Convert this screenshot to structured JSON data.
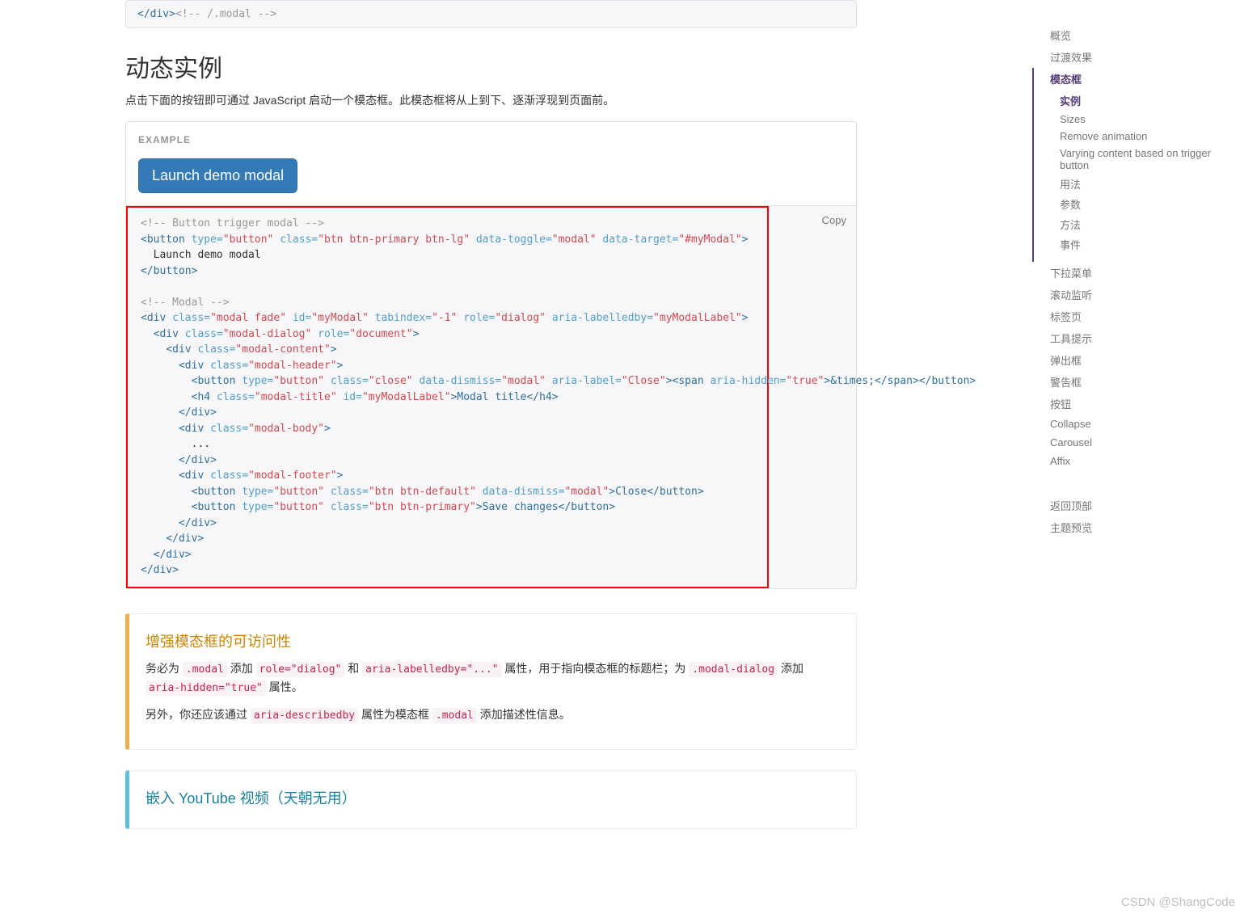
{
  "pretop": {
    "closing_tag": "</div>",
    "comment": "<!-- /.modal -->"
  },
  "section": {
    "title": "动态实例",
    "desc": "点击下面的按钮即可通过 JavaScript 启动一个模态框。此模态框将从上到下、逐渐浮现到页面前。"
  },
  "example": {
    "label": "EXAMPLE",
    "button_label": "Launch demo modal"
  },
  "code_actions": {
    "copy": "Copy"
  },
  "code": {
    "c1": "<!-- Button trigger modal -->",
    "btn_open": "<button",
    "type_attr": "type=",
    "type_val": "\"button\"",
    "class_attr": "class=",
    "btn_class_val": "\"btn btn-primary btn-lg\"",
    "toggle_attr": "data-toggle=",
    "toggle_val": "\"modal\"",
    "target_attr": "data-target=",
    "target_val": "\"#myModal\"",
    "gt": ">",
    "btn_text": "  Launch demo modal",
    "btn_close": "</button>",
    "c2": "<!-- Modal -->",
    "div_open": "<div",
    "modal_class_val": "\"modal fade\"",
    "id_attr": "id=",
    "modal_id_val": "\"myModal\"",
    "tabindex_attr": "tabindex=",
    "tabindex_val": "\"-1\"",
    "role_attr": "role=",
    "role_dialog_val": "\"dialog\"",
    "aria_lb_attr": "aria-labelledby=",
    "aria_lb_val": "\"myModalLabel\"",
    "dialog_class_val": "\"modal-dialog\"",
    "role_doc_val": "\"document\"",
    "content_class_val": "\"modal-content\"",
    "header_class_val": "\"modal-header\"",
    "close_class_val": "\"close\"",
    "dismiss_attr": "data-dismiss=",
    "dismiss_val": "\"modal\"",
    "aria_label_attr": "aria-label=",
    "aria_label_val": "\"Close\"",
    "span_open": "><span",
    "aria_hidden_attr": "aria-hidden=",
    "aria_hidden_val": "\"true\"",
    "times": ">&times;",
    "span_close": "</span>",
    "button_close_tag": "</button>",
    "h4_open": "<h4",
    "title_class_val": "\"modal-title\"",
    "title_id_val": "\"myModalLabel\"",
    "title_text": ">Modal title",
    "h4_close": "</h4>",
    "div_close": "</div>",
    "body_class_val": "\"modal-body\"",
    "ellipsis": "...",
    "footer_class_val": "\"modal-footer\"",
    "btn_default_val": "\"btn btn-default\"",
    "close_text": ">Close",
    "btn_primary_val": "\"btn btn-primary\"",
    "save_text": ">Save changes"
  },
  "callout": {
    "title": "增强模态框的可访问性",
    "p1_a": "务必为 ",
    "p1_code1": ".modal",
    "p1_b": " 添加 ",
    "p1_code2": "role=\"dialog\"",
    "p1_c": " 和 ",
    "p1_code3": "aria-labelledby=\"...\"",
    "p1_d": " 属性，用于指向模态框的标题栏；为 ",
    "p1_code4": ".modal-dialog",
    "p1_e": " 添加 ",
    "p1_code5": "aria-hidden=\"true\"",
    "p1_f": " 属性。",
    "p2_a": "另外，你还应该通过 ",
    "p2_code1": "aria-describedby",
    "p2_b": " 属性为模态框 ",
    "p2_code2": ".modal",
    "p2_c": " 添加描述性信息。"
  },
  "callout2": {
    "title": "嵌入 YouTube 视频（天朝无用）"
  },
  "sidebar": {
    "items": [
      {
        "label": "概览"
      },
      {
        "label": "过渡效果"
      },
      {
        "label": "模态框",
        "active": true,
        "children": [
          {
            "label": "实例",
            "active": true
          },
          {
            "label": "Sizes"
          },
          {
            "label": "Remove animation"
          },
          {
            "label": "Varying content based on trigger button"
          },
          {
            "label": "用法"
          },
          {
            "label": "参数"
          },
          {
            "label": "方法"
          },
          {
            "label": "事件"
          }
        ]
      },
      {
        "label": "下拉菜单"
      },
      {
        "label": "滚动监听"
      },
      {
        "label": "标签页"
      },
      {
        "label": "工具提示"
      },
      {
        "label": "弹出框"
      },
      {
        "label": "警告框"
      },
      {
        "label": "按钮"
      },
      {
        "label": "Collapse"
      },
      {
        "label": "Carousel"
      },
      {
        "label": "Affix"
      }
    ],
    "back_top": "返回顶部",
    "theme_preview": "主题预览"
  },
  "watermark": "CSDN @ShangCode"
}
